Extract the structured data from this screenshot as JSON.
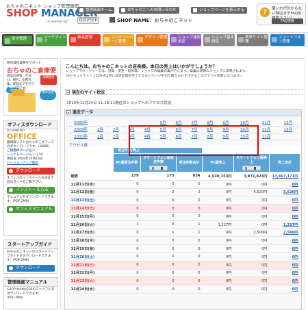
{
  "header": {
    "sub": "おちゃのこネット ショップ管理画面",
    "logo_a": "SHOP ",
    "logo_b": "MANAGER",
    "domain": "OCHANOKO-NET",
    "top_buttons": [
      "管理画面ホーム",
      "おちゃのこへのお問い合わせ",
      "ショップページを表示する"
    ],
    "logout": "ログアウト",
    "shop_label": "SHOP NAME：",
    "shop_value": "おちゃのこネット",
    "faq_text": "使い方が分からない時はまずFAQを検索下さい！",
    "faq_button": "FAQ検索"
  },
  "nav": {
    "tabs": [
      {
        "label": "受注管理",
        "color": "#4a9a3a"
      },
      {
        "label": "マーケティング",
        "color": "#4aa040"
      },
      {
        "label": "商品管理",
        "color": "#e03a2f"
      },
      {
        "label": "コンテンツページ管理",
        "color": "#e8a020"
      },
      {
        "label": "デザイン管理",
        "color": "#e8781a"
      },
      {
        "label": "ショップ運用設定",
        "color": "#8a5cb8"
      },
      {
        "label": "ショップ基本設定",
        "color": "#8a8a8a"
      },
      {
        "label": "携帯サイト管理",
        "color": "#7a7a7a"
      },
      {
        "label": "スマートフォン管理",
        "color": "#2a7cc2"
      }
    ]
  },
  "sidebar": {
    "ad_sub": "梱包資材業務をサポート",
    "ad_title": "おちゃのこ倉庫便",
    "ad_desc": "商品の保管、仕分け、梱包、出荷作業、配送までを行うサービスです。",
    "ad_badge1": "格安",
    "ad_badge2": "簡単管理",
    "ad_badge3": "期間限定",
    "office_title": "オフィスダウンロード",
    "office_logo": "OFFICE",
    "office_logo_sub": "OCHANOKO",
    "office_desc": "最新版ソフトおちゃのこオフィスのダウンロードです。(36MB)",
    "office_ver_link": "ご利用のバージョン",
    "office_ver": "システムバージョン:1.50",
    "office_date": "更新日:2009年10月16日",
    "office_check": "バージョンアップ履歴",
    "office_dl": "ダウンロード",
    "office_note": "オフィスのインストール方法は下記のガイドをご覧下さい。",
    "office_install": "インストール方法",
    "office_manual_note": "マニュアルをダウンロードできます。(PDF:2MB)",
    "office_manual": "オフィスマニュアル",
    "startup_title": "スタートアップガイド",
    "startup_desc": "おちゃのこネットのスタートアップガイドをダウンロードできます。(PDF:2MB)",
    "startup_dl": "ダウンロード",
    "manual_title": "管理画面マニュアル",
    "manual_desc": "SHOP MANAGERのマニュアルをダウンロードできます。(PDF:3MB)"
  },
  "main": {
    "greeting": "こんにちは。おちゃのこネットの店長様。本日の売上はいかがでしょうか？",
    "sub1": "ショップマネージャーでは、登録・変更・削除等、ショップの編集作業が行えます。編集は同時にショップに反映されます。",
    "sub2": "(※セキュリティー上120分以内に設定処理を完了するなどページを切り替えられずさせるとログアウト状態になります。)",
    "section": "現在のサイト状況",
    "date": "2010年11月24日 11:18:11現在のショップへのアクセス状況",
    "past": "過去データ",
    "access_tab": "アクセス数",
    "years": [
      {
        "y": "2008年",
        "m": [
          "",
          "",
          "",
          "",
          "5月",
          "6月",
          "7月",
          "8月",
          "9月",
          "10月",
          "11月",
          "12月"
        ]
      },
      {
        "y": "2009年",
        "m": [
          "1月",
          "2月",
          "3月",
          "4月",
          "5月",
          "6月",
          "7月",
          "8月",
          "9月",
          "10月",
          "11月",
          "12月"
        ]
      },
      {
        "y": "2010年",
        "m": [
          "1月",
          "2月",
          "3月",
          "4月",
          "5月",
          "6月",
          "7月",
          "8月",
          "9月",
          "10月",
          "11月",
          ""
        ]
      }
    ],
    "cols": [
      "受注件数/売上",
      "PC版受注件数",
      "スマートフォン版受注件数",
      "受注件数合計",
      "PC版売上",
      "スマートフォン版売上",
      "売上合計"
    ],
    "total": {
      "label": "総数",
      "v": [
        "279",
        "175",
        "634",
        "4,539,153円",
        "3,971,823円",
        "13,467,171円"
      ]
    },
    "rows": [
      {
        "d": "11月11日(木)",
        "t": "",
        "v": [
          "0",
          "0",
          "0",
          "0円",
          "0円",
          "0円"
        ]
      },
      {
        "d": "11月12日(金)",
        "t": "",
        "v": [
          "0",
          "2",
          "2",
          "0円",
          "5,620円",
          "5,620円"
        ]
      },
      {
        "d": "11月13日(土)",
        "t": "sat",
        "v": [
          "0",
          "0",
          "0",
          "0円",
          "0円",
          "0円"
        ]
      },
      {
        "d": "11月14日(日)",
        "t": "sun",
        "v": [
          "0",
          "0",
          "0",
          "0円",
          "0円",
          "0円"
        ]
      },
      {
        "d": "11月15日(月)",
        "t": "",
        "v": [
          "0",
          "0",
          "0",
          "0円",
          "0円",
          "0円"
        ]
      },
      {
        "d": "11月16日(火)",
        "t": "",
        "v": [
          "1",
          "0",
          "1",
          "1,227円",
          "0円",
          "1,227円"
        ]
      },
      {
        "d": "11月17日(水)",
        "t": "",
        "v": [
          "0",
          "1",
          "1",
          "0円",
          "2,500円",
          "2,500円"
        ]
      },
      {
        "d": "11月18日(木)",
        "t": "",
        "v": [
          "0",
          "0",
          "0",
          "0円",
          "0円",
          "0円"
        ]
      },
      {
        "d": "11月19日(金)",
        "t": "",
        "v": [
          "0",
          "0",
          "0",
          "0円",
          "0円",
          "0円"
        ]
      },
      {
        "d": "11月20日(土)",
        "t": "sat",
        "v": [
          "0",
          "0",
          "0",
          "0円",
          "0円",
          "0円"
        ]
      },
      {
        "d": "11月21日(日)",
        "t": "sun",
        "v": [
          "0",
          "0",
          "0",
          "0円",
          "0円",
          "0円"
        ]
      },
      {
        "d": "11月22日(月)",
        "t": "",
        "v": [
          "0",
          "0",
          "0",
          "0円",
          "0円",
          "0円"
        ]
      },
      {
        "d": "11月23日(火)",
        "t": "sun",
        "v": [
          "0",
          "0",
          "0",
          "0円",
          "0円",
          "0円"
        ]
      },
      {
        "d": "11月24日(水)",
        "t": "",
        "v": [
          "0",
          "0",
          "0",
          "0円",
          "0円",
          "0円"
        ]
      }
    ]
  }
}
